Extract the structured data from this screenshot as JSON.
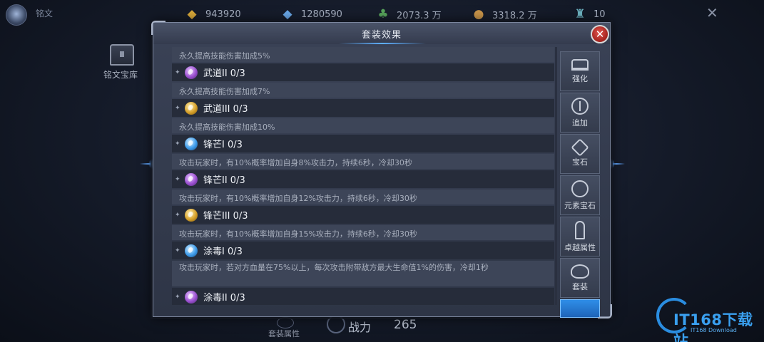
{
  "topbar": {
    "title": "铭文",
    "resources": [
      {
        "icon": "gold-diamond-icon",
        "value": "943920"
      },
      {
        "icon": "blue-diamond-icon",
        "value": "1280590"
      },
      {
        "icon": "green-ore-icon",
        "value": "2073.3 万"
      },
      {
        "icon": "gold-coin-icon",
        "value": "3318.2 万"
      },
      {
        "icon": "potion-icon",
        "value": "10"
      }
    ]
  },
  "background": {
    "chest_label": "铭文宝库",
    "set_attr_label": "套装属性",
    "power_label": "战力",
    "power_value": "265"
  },
  "dialog": {
    "title": "套装效果",
    "rows": [
      {
        "desc": "永久提高技能伤害加成5%"
      },
      {
        "item": "武道II 0/3",
        "gem": "purple"
      },
      {
        "desc": "永久提高技能伤害加成7%"
      },
      {
        "item": "武道III 0/3",
        "gem": "gold"
      },
      {
        "desc": "永久提高技能伤害加成10%"
      },
      {
        "item": "锋芒I 0/3",
        "gem": "blue"
      },
      {
        "desc": "攻击玩家时，有10%概率增加自身8%攻击力，持续6秒，冷却30秒"
      },
      {
        "item": "锋芒II 0/3",
        "gem": "purple"
      },
      {
        "desc": "攻击玩家时，有10%概率增加自身12%攻击力，持续6秒，冷却30秒"
      },
      {
        "item": "锋芒III 0/3",
        "gem": "gold"
      },
      {
        "desc": "攻击玩家时，有10%概率增加自身15%攻击力，持续6秒，冷却30秒"
      },
      {
        "item": "涂毒I 0/3",
        "gem": "blue"
      },
      {
        "desc": "攻击玩家时，若对方血量在75%以上，每次攻击附带敌方最大生命值1%的伤害，冷却1秒"
      },
      {
        "item": "涂毒II 0/3",
        "gem": "purple"
      }
    ],
    "tabs": [
      {
        "label": "强化",
        "icon": "anvil-icon"
      },
      {
        "label": "追加",
        "icon": "add-icon"
      },
      {
        "label": "宝石",
        "icon": "gem-icon"
      },
      {
        "label": "元素宝石",
        "icon": "element-gem-icon"
      },
      {
        "label": "卓越属性",
        "icon": "sword-icon"
      },
      {
        "label": "套装",
        "icon": "wing-icon"
      }
    ]
  },
  "watermark": {
    "text": "IT168下载站",
    "sub": "IT168 Download"
  }
}
